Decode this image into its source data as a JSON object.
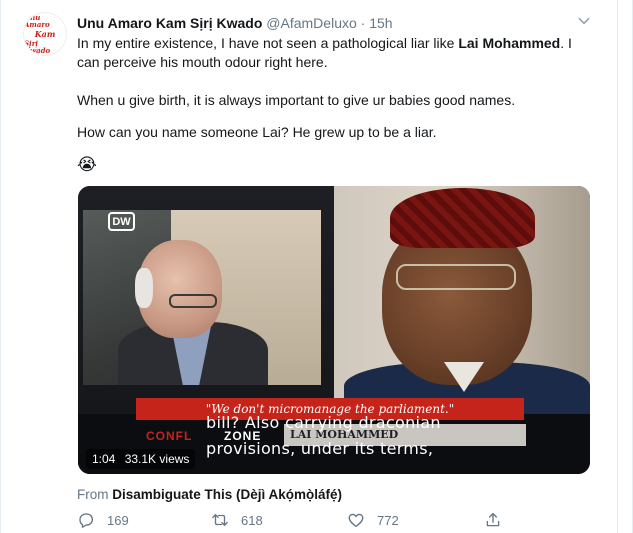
{
  "tweet": {
    "display_name": "Unu Amaro Kam Sịrị Kwado",
    "handle": "@AfamDeluxo",
    "separator": "·",
    "time": "15h",
    "avatar_text": [
      "Unu Amaro",
      "Kam",
      "Sịrị Kwado"
    ],
    "paragraph1_before": "In my entire existence, I have not seen a pathological liar like ",
    "paragraph1_bold": "Lai Mohammed",
    "paragraph1_after": ". I can perceive his mouth odour right here.",
    "paragraph2": "When u give birth, it is always important to give ur babies good names.",
    "paragraph3": "How can you name someone Lai? He grew up to be a liar.",
    "emoji": "😭"
  },
  "media": {
    "logo_text": "DW",
    "quote_caption": "\"We don't micromanage the parliament.\"",
    "show_left": "CONFL",
    "show_right": "ZONE",
    "lower_name": "LAI MOHAMMED",
    "subtitle_line1": "bill? Also carrying draconian",
    "subtitle_line2": "provisions, under its terms,",
    "duration": "1:04",
    "views": "33.1K views"
  },
  "from": {
    "label": "From",
    "source": "Disambiguate This (Dèjì Akọ́mọ̀láfẹ́)"
  },
  "actions": {
    "replies": "169",
    "retweets": "618",
    "likes": "772"
  }
}
